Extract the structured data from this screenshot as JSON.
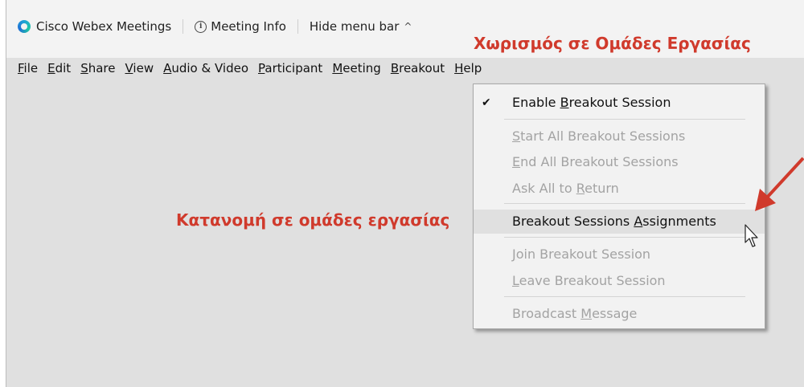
{
  "titlebar": {
    "app_name": "Cisco Webex Meetings",
    "meeting_info": "Meeting Info",
    "hide_menu": "Hide menu bar",
    "chevron": "^"
  },
  "menubar": {
    "items": [
      {
        "first": "F",
        "rest": "ile"
      },
      {
        "first": "E",
        "rest": "dit"
      },
      {
        "first": "S",
        "rest": "hare"
      },
      {
        "first": "V",
        "rest": "iew"
      },
      {
        "first": "A",
        "rest": "udio & Video"
      },
      {
        "first": "P",
        "rest": "articipant"
      },
      {
        "first": "M",
        "rest": "eeting"
      },
      {
        "first": "B",
        "rest": "reakout"
      },
      {
        "first": "H",
        "rest": "elp"
      }
    ]
  },
  "annotations": {
    "top": "Χωρισμός σε Ομάδες Εργασίας",
    "middle": "Κατανομή σε ομάδες εργασίας",
    "color": "#d03a2c"
  },
  "dropdown": {
    "checkmark": "✔",
    "enable": {
      "pre": "Enable ",
      "u": "B",
      "post": "reakout Session"
    },
    "start_all": {
      "pre": "",
      "u": "S",
      "post": "tart All Breakout Sessions"
    },
    "end_all": {
      "pre": "",
      "u": "E",
      "post": "nd All Breakout Sessions"
    },
    "ask_return": {
      "pre": "Ask All to ",
      "u": "R",
      "post": "eturn"
    },
    "assignments": {
      "pre": "Breakout Sessions ",
      "u": "A",
      "post": "ssignments"
    },
    "join": {
      "pre": "",
      "u": "J",
      "post": "oin Breakout Session"
    },
    "leave": {
      "pre": "",
      "u": "L",
      "post": "eave Breakout Session"
    },
    "broadcast": {
      "pre": "Broadcast ",
      "u": "M",
      "post": "essage"
    }
  }
}
